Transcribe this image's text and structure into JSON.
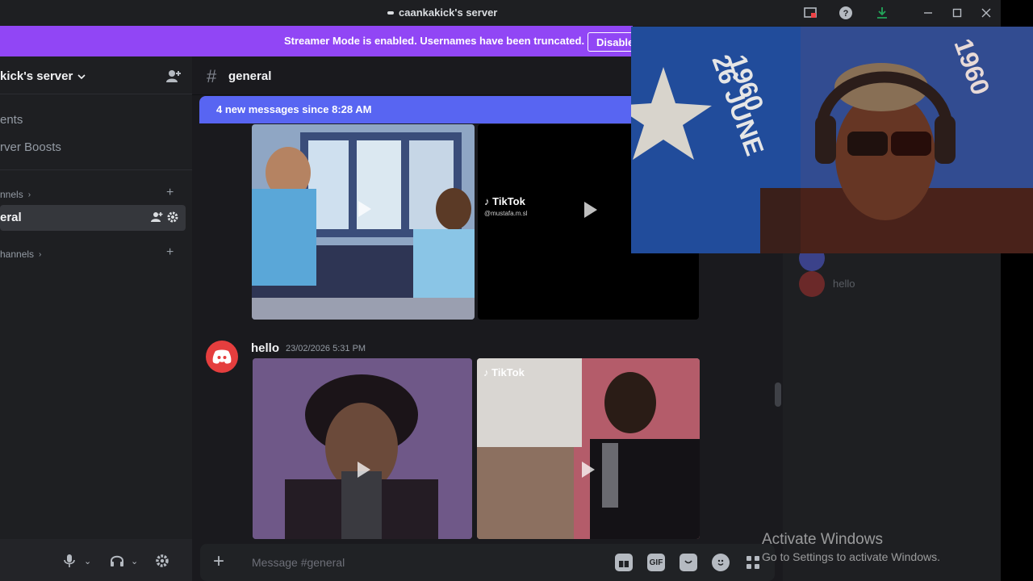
{
  "window": {
    "title": "caankakick's server",
    "icons": [
      "inbox-icon",
      "help-icon",
      "download-icon",
      "minimize-icon",
      "maximize-icon",
      "close-icon"
    ]
  },
  "banner": {
    "text": "Streamer Mode is enabled. Usernames have been truncated.",
    "button": "Disable",
    "color": "#9146f5"
  },
  "sidebar": {
    "server_name": "kick's server",
    "items": [
      {
        "label": "ents"
      },
      {
        "label": "rver Boosts"
      }
    ],
    "categories": [
      {
        "label": "nnels"
      },
      {
        "label": "hannels"
      }
    ],
    "selected_channel": "eral"
  },
  "chat": {
    "channel": "general",
    "new_messages": "4 new messages since 8:28 AM",
    "tiktok_label": "TikTok",
    "tiktok_handle": "@mustafa.m.sl",
    "message": {
      "author": "hello",
      "timestamp": "23/02/2026 5:31 PM"
    },
    "composer_placeholder": "Message #general",
    "composer_icons": [
      "gift-icon",
      "gif-icon",
      "sticker-icon",
      "emoji-icon",
      "apps-icon"
    ]
  },
  "members": {
    "names": [
      "hello"
    ]
  },
  "watermark": {
    "line1": "Activate Windows",
    "line2": "Go to Settings to activate Windows."
  },
  "webcam": {
    "flag_text_1": "1960",
    "flag_text_2": "26 JUNE"
  },
  "colors": {
    "accent": "#5865f2",
    "avatar_red": "#e53e3e"
  }
}
